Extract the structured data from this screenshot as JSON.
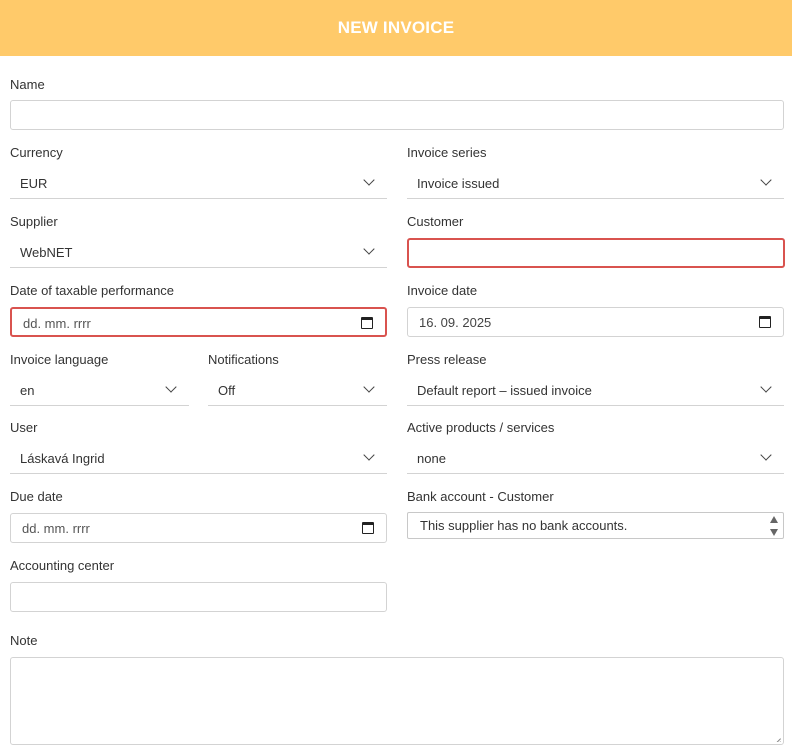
{
  "header": {
    "title": "NEW INVOICE"
  },
  "form": {
    "name": {
      "label": "Name",
      "value": ""
    },
    "currency": {
      "label": "Currency",
      "value": "EUR"
    },
    "invoice_series": {
      "label": "Invoice series",
      "value": "Invoice issued"
    },
    "supplier": {
      "label": "Supplier",
      "value": "WebNET"
    },
    "customer": {
      "label": "Customer",
      "value": ""
    },
    "taxable_date": {
      "label": "Date of taxable performance",
      "placeholder": "dd. mm. rrrr"
    },
    "invoice_date": {
      "label": "Invoice date",
      "value": "16. 09. 2025"
    },
    "invoice_language": {
      "label": "Invoice language",
      "value": "en"
    },
    "notifications": {
      "label": "Notifications",
      "value": "Off"
    },
    "press_release": {
      "label": "Press release",
      "value": "Default report – issued invoice"
    },
    "user": {
      "label": "User",
      "value": "Láskavá Ingrid"
    },
    "active_products": {
      "label": "Active products / services",
      "value": "none"
    },
    "due_date": {
      "label": "Due date",
      "placeholder": "dd. mm. rrrr"
    },
    "bank_account": {
      "label": "Bank account - Customer",
      "value": "This supplier has no bank accounts."
    },
    "accounting_center": {
      "label": "Accounting center",
      "value": ""
    },
    "note": {
      "label": "Note",
      "value": ""
    }
  },
  "colors": {
    "header_bg": "#ffca6a",
    "error_border": "#d9534f",
    "field_border": "#d3d3d3"
  },
  "icons": [
    "chevron-down-icon",
    "calendar-icon",
    "spin-up-icon",
    "spin-down-icon",
    "resize-grip-icon"
  ]
}
